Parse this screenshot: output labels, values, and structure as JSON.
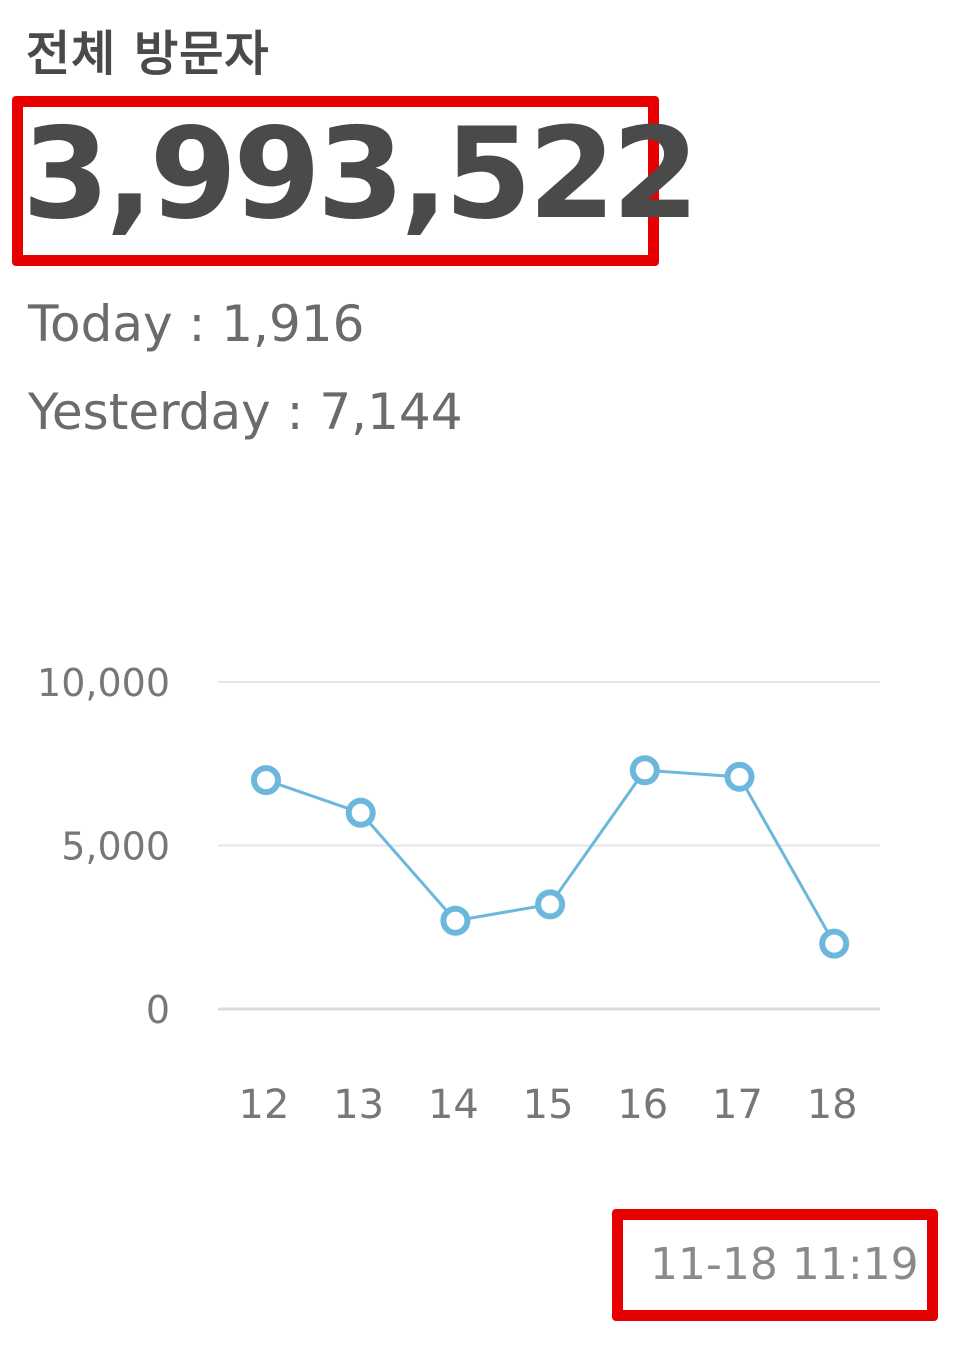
{
  "widget": {
    "title": "전체 방문자",
    "total": "3,993,522",
    "today_label": "Today",
    "today_sep": " : ",
    "today_value": "1,916",
    "yesterday_label": "Yesterday",
    "yesterday_sep": " : ",
    "yesterday_value": "7,144",
    "updated_at": "11-18 11:19"
  },
  "colors": {
    "highlight": "#e60000",
    "line": "#6cb8dd",
    "grid": "#e6e6e6",
    "text": "#4a4a4a"
  },
  "chart_data": {
    "type": "line",
    "categories": [
      "12",
      "13",
      "14",
      "15",
      "16",
      "17",
      "18"
    ],
    "values": [
      7000,
      6000,
      2700,
      3200,
      7300,
      7100,
      2000
    ],
    "y_ticks": [
      "0",
      "5,000",
      "10,000"
    ],
    "ylim": [
      0,
      10000
    ],
    "grid": true,
    "legend": "none"
  }
}
